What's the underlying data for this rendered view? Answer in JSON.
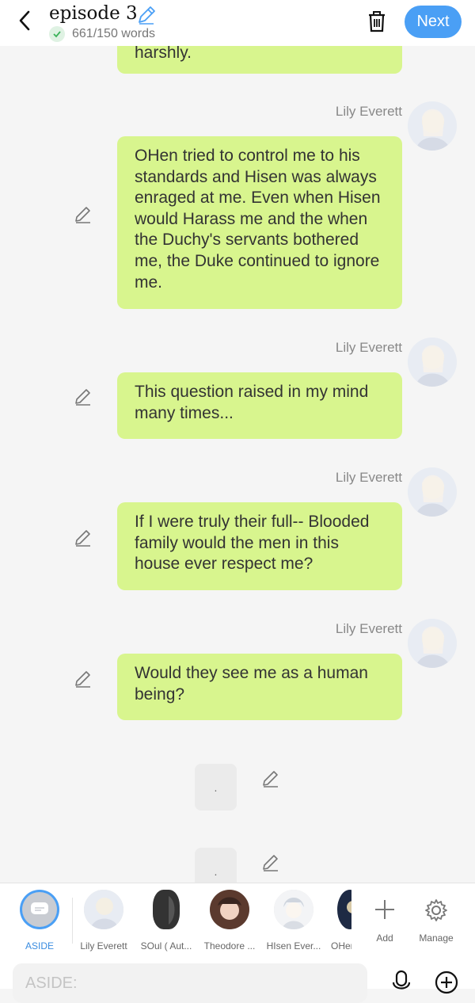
{
  "header": {
    "title": "episode 3",
    "word_count": "661/150 words",
    "next_label": "Next"
  },
  "messages": [
    {
      "text": "harshly."
    },
    {
      "speaker": "Lily Everett",
      "text": "OHen tried to control me to his standards and Hisen was always enraged at me. Even when Hisen would Harass me and the when the Duchy's servants bothered me, the Duke continued to ignore me."
    },
    {
      "speaker": "Lily Everett",
      "text": "This question raised in my mind many times..."
    },
    {
      "speaker": "Lily Everett",
      "text": "If I were truly their full-- Blooded family would the men in this house ever respect me?"
    },
    {
      "speaker": "Lily Everett",
      "text": "Would they see me as a human being?"
    }
  ],
  "asides": [
    {
      "text": "."
    },
    {
      "text": "."
    }
  ],
  "characters": [
    {
      "label": "ASIDE",
      "icon": "aside-icon"
    },
    {
      "label": "Lily Everett"
    },
    {
      "label": "SOul ( Aut..."
    },
    {
      "label": "Theodore ..."
    },
    {
      "label": "HIsen Ever..."
    },
    {
      "label": "OHen"
    }
  ],
  "actions": {
    "add": "Add",
    "manage": "Manage"
  },
  "composer": {
    "placeholder": "ASIDE:"
  },
  "colors": {
    "accent": "#4a9ff5",
    "bubble": "#d8f58e"
  }
}
